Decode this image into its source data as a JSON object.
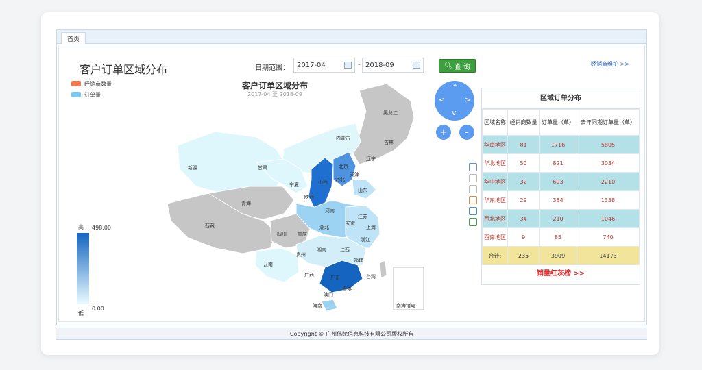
{
  "tab": {
    "label": "首页"
  },
  "page_title": "客户订单区域分布",
  "legend": [
    {
      "label": "经销商数量",
      "color": "#f07b51"
    },
    {
      "label": "订单量",
      "color": "#7ec7ef"
    }
  ],
  "filter": {
    "label": "日期范围：",
    "start": "2017-04",
    "separator": "-",
    "end": "2018-09",
    "query_label": "查 询"
  },
  "dealer_link": "经销商维护 >>",
  "map": {
    "title": "客户订单区域分布",
    "subtitle": "2017-04 至 2018-09",
    "range_high": "高",
    "range_low": "低",
    "range_max": "498.00",
    "range_min": "0.00",
    "nav": {
      "up": "^",
      "down": "v",
      "left": "<",
      "right": ">",
      "zoom_in": "+",
      "zoom_out": "-"
    },
    "provinces": [
      "黑龙江",
      "吉林",
      "辽宁",
      "内蒙古",
      "新疆",
      "甘肃",
      "宁夏",
      "北京",
      "天津",
      "河北",
      "山西",
      "山东",
      "陕西",
      "青海",
      "西藏",
      "河南",
      "江苏",
      "安徽",
      "上海",
      "湖北",
      "四川",
      "重庆",
      "浙江",
      "贵州",
      "湖南",
      "江西",
      "福建",
      "云南",
      "广西",
      "广东",
      "台湾",
      "香港",
      "澳门",
      "海南",
      "南海诸岛"
    ]
  },
  "panel": {
    "title": "区域订单分布",
    "headers": [
      "区域名称",
      "经销商数量",
      "订单量（单）",
      "去年同期订单量（单）"
    ],
    "rows": [
      [
        "华南地区",
        "81",
        "1716",
        "5805"
      ],
      [
        "华北地区",
        "50",
        "821",
        "3034"
      ],
      [
        "华中地区",
        "32",
        "693",
        "2210"
      ],
      [
        "华东地区",
        "29",
        "384",
        "1338"
      ],
      [
        "西北地区",
        "34",
        "210",
        "1046"
      ],
      [
        "西南地区",
        "9",
        "85",
        "740"
      ]
    ],
    "total": [
      "合计:",
      "235",
      "3909",
      "14173"
    ],
    "ranking_link": "销量红灰榜 >>"
  },
  "footer": "Copyright © 广州伟纶信息科技有限公司版权所有"
}
